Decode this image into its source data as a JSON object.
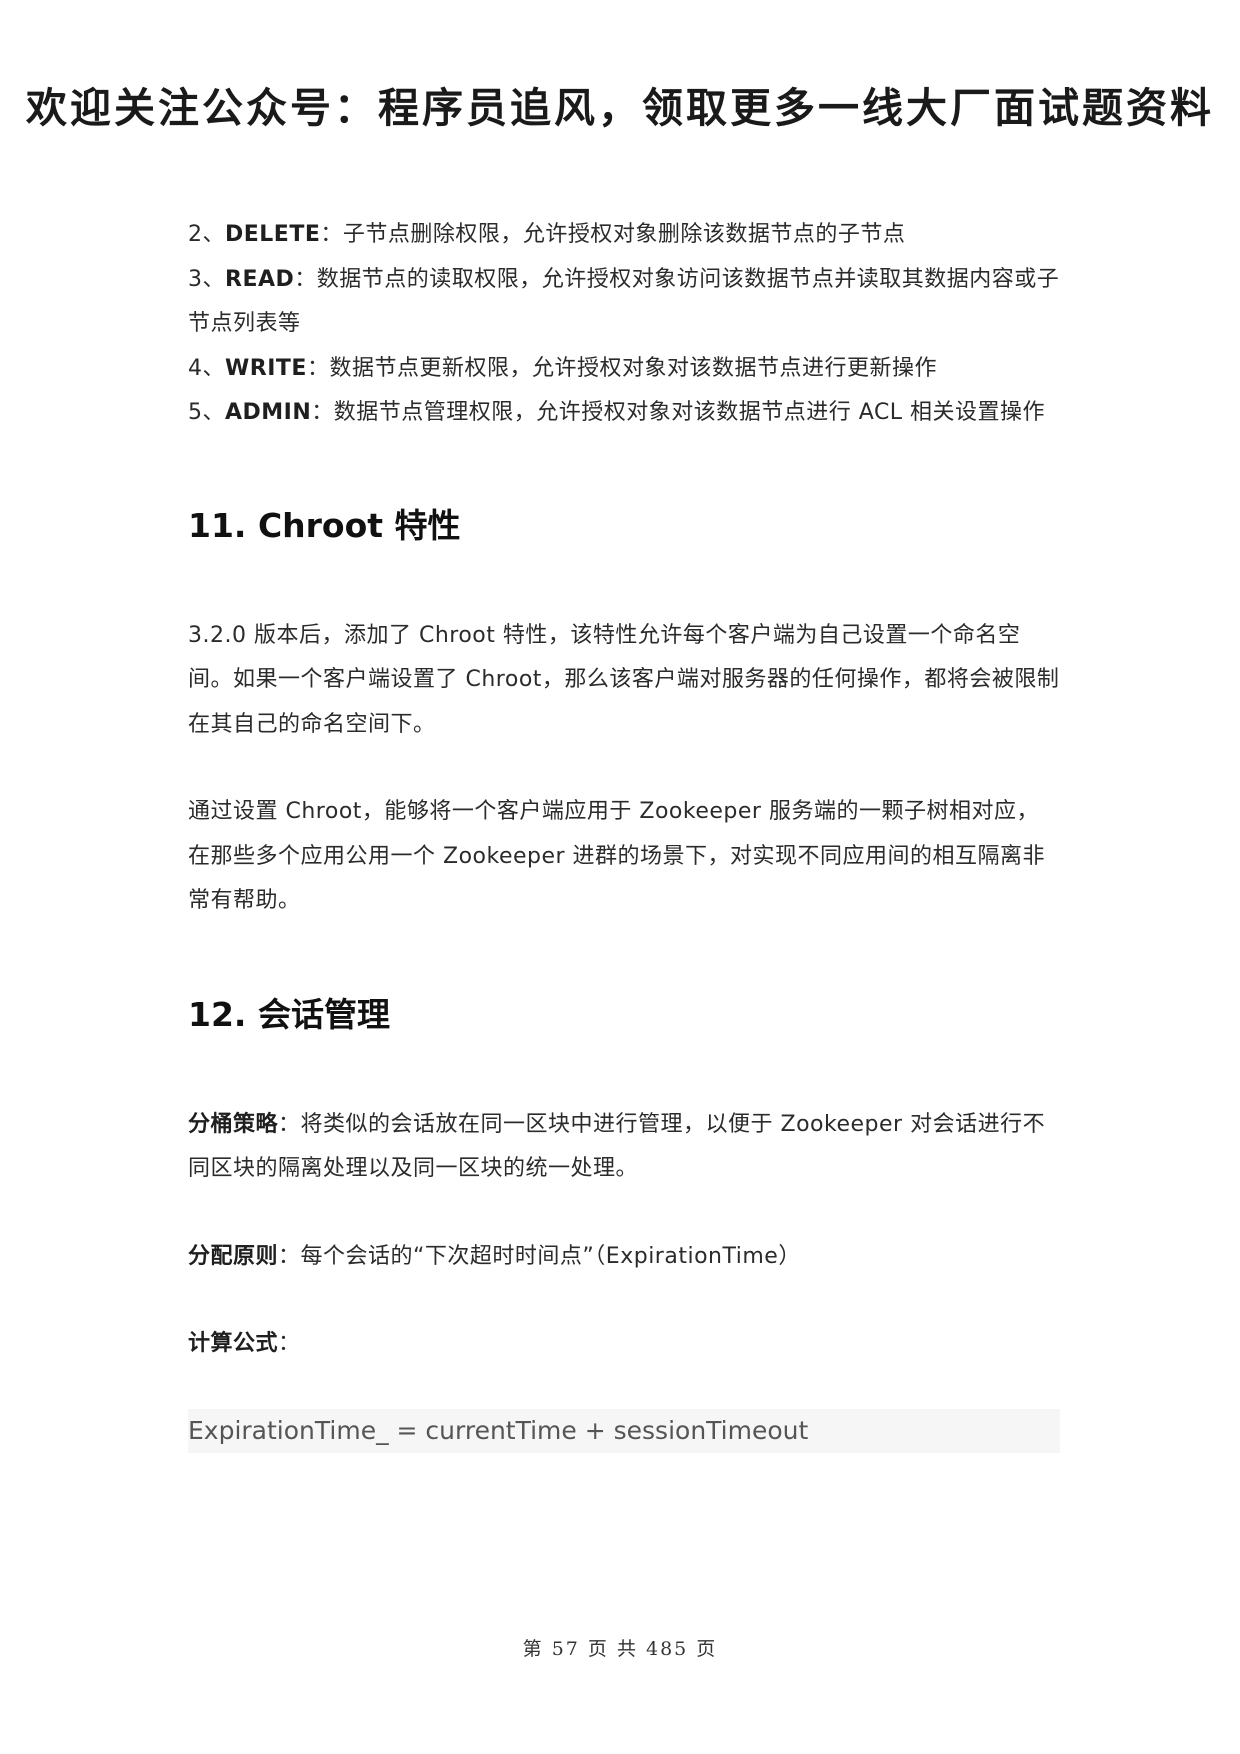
{
  "banner": "欢迎关注公众号：程序员追风，领取更多一线大厂面试题资料",
  "permissions": [
    {
      "num": "2、",
      "name": "DELETE",
      "desc": "：子节点删除权限，允许授权对象删除该数据节点的子节点"
    },
    {
      "num": "3、",
      "name": "READ",
      "desc": "：数据节点的读取权限，允许授权对象访问该数据节点并读取其数据内容或子节点列表等"
    },
    {
      "num": "4、",
      "name": "WRITE",
      "desc": "：数据节点更新权限，允许授权对象对该数据节点进行更新操作"
    },
    {
      "num": "5、",
      "name": "ADMIN",
      "desc": "：数据节点管理权限，允许授权对象对该数据节点进行 ACL 相关设置操作"
    }
  ],
  "section11": {
    "heading": "11. Chroot 特性",
    "para1": "3.2.0 版本后，添加了  Chroot 特性，该特性允许每个客户端为自己设置一个命名空间。如果一个客户端设置了 Chroot，那么该客户端对服务器的任何操作，都将会被限制在其自己的命名空间下。",
    "para2": "通过设置 Chroot，能够将一个客户端应用于 Zookeeper 服务端的一颗子树相对应，在那些多个应用公用一个 Zookeeper 进群的场景下，对实现不同应用间的相互隔离非常有帮助。"
  },
  "section12": {
    "heading": "12. 会话管理",
    "bucket_label": "分桶策略",
    "bucket_text": "：将类似的会话放在同一区块中进行管理，以便于 Zookeeper 对会话进行不同区块的隔离处理以及同一区块的统一处理。",
    "alloc_label": "分配原则",
    "alloc_text": "：每个会话的“下次超时时间点”（ExpirationTime）",
    "formula_label": "计算公式",
    "formula_colon": "：",
    "formula": "ExpirationTime_ = currentTime + sessionTimeout"
  },
  "footer": "第 57 页 共 485 页"
}
